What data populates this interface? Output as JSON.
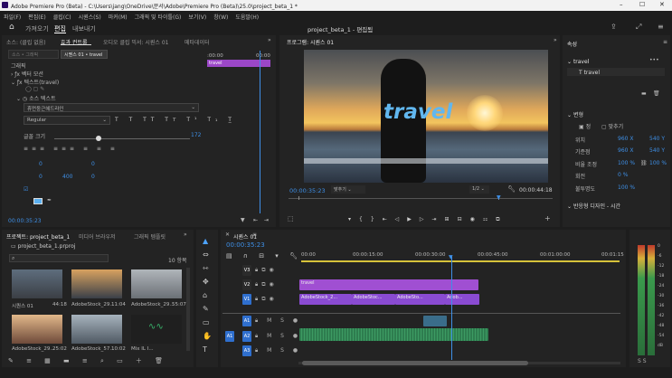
{
  "window": {
    "title": "Adobe Premiere Pro (Beta) - C:\\Users\\jang\\OneDrive\\문서\\Adobe\\Premiere Pro (Beta)\\25.0\\project_beta_1 *"
  },
  "menu": [
    "파일(F)",
    "편집(E)",
    "클립(C)",
    "시퀀스(S)",
    "마커(M)",
    "그래픽 및 타이틀(G)",
    "보기(V)",
    "창(W)",
    "도움말(H)"
  ],
  "workspace": {
    "tabs": [
      "가져오기",
      "편집",
      "내보내기"
    ],
    "active": "편집",
    "center_title": "project_beta_1 - 편집됨"
  },
  "source_panel": {
    "tabs": [
      "소스: (클립 없음)",
      "효과 컨트롤",
      "오디오 클립 믹서: 시퀀스 01",
      "메타데이터"
    ],
    "source_dropdown": "소스 • 그래픽",
    "sequence_dropdown": "시퀀스 01 • travel",
    "timecode_start": ":00:00",
    "timecode_end": "00:00",
    "clip_label": "travel",
    "section_graphics": "그래픽",
    "motion": "벡터 모션",
    "text_layer": "텍스트(travel)",
    "source_text": "소스 텍스트",
    "font": "휴먼둥근헤드라인",
    "style": "Regular",
    "size_label": "글꼴 크기",
    "size_value": "172",
    "val_0a": "0",
    "val_0b": "0",
    "val_0c": "0",
    "val_0d": "0",
    "val_400": "400",
    "val_0e": "0",
    "timecode": "00:00:35:23"
  },
  "program_monitor": {
    "tab": "프로그램: 시퀀스 01",
    "overlay_text": "travel",
    "timecode": "00:00:35:23",
    "fit": "맞추기",
    "quality": "1/2",
    "duration": "00:00:44:18"
  },
  "properties": {
    "tab": "속성",
    "layer_name": "travel",
    "sub_item": "travel",
    "section_transform": "변형",
    "toggle_a": "정",
    "toggle_b": "맞추기",
    "rows": [
      {
        "label": "위치",
        "v1": "960 X",
        "v2": "540 Y"
      },
      {
        "label": "기준점",
        "v1": "960 X",
        "v2": "540 Y"
      },
      {
        "label": "비율 조정",
        "v1": "100 %",
        "v2": "100 %"
      },
      {
        "label": "회전",
        "v1": "0 %",
        "v2": ""
      },
      {
        "label": "불투명도",
        "v1": "100 %",
        "v2": ""
      }
    ],
    "section_design": "반응형 디자인 - 시간"
  },
  "project_panel": {
    "tabs": [
      "프로젝트: project_beta_1",
      "미디어 브라우저",
      "그래픽 템플릿"
    ],
    "file": "project_beta_1.prproj",
    "count": "10 항목",
    "items": [
      {
        "name": "시퀀스 01",
        "dur": "44:18"
      },
      {
        "name": "AdobeStock_29...",
        "dur": "11:04"
      },
      {
        "name": "AdobeStock_29...",
        "dur": "55:07"
      },
      {
        "name": "AdobeStock_29...",
        "dur": "25:02"
      },
      {
        "name": "AdobeStock_57...",
        "dur": "10:02"
      },
      {
        "name": "Mix IL I...",
        "dur": ""
      }
    ]
  },
  "timeline": {
    "tab": "시퀀스 01",
    "timecode": "00:00:35:23",
    "ruler": [
      "00:00",
      "00:00:15:00",
      "00:00:30:00",
      "00:00:45:00",
      "00:01:00:00",
      "00:01:15"
    ],
    "tracks": [
      "V3",
      "V2",
      "V1",
      "A1",
      "A2",
      "A3"
    ],
    "source_v": "V1",
    "source_a": "A1",
    "clips": [
      {
        "label": "travel"
      },
      {
        "label": "AdobeStock_2..."
      },
      {
        "label": "AdobeStoc..."
      },
      {
        "label": "AdobeSto..."
      },
      {
        "label": "Adob..."
      }
    ]
  },
  "meter_scale": [
    "0",
    "-6",
    "-12",
    "-18",
    "-24",
    "-30",
    "-36",
    "-42",
    "-48",
    "-54",
    "dB"
  ],
  "colors": {
    "accent": "#3e8fe6",
    "clip_purple": "#8a4bd2",
    "clip_title": "#a04fd2",
    "audio_green": "#2e7d4f",
    "playhead": "#3e8fe6"
  }
}
